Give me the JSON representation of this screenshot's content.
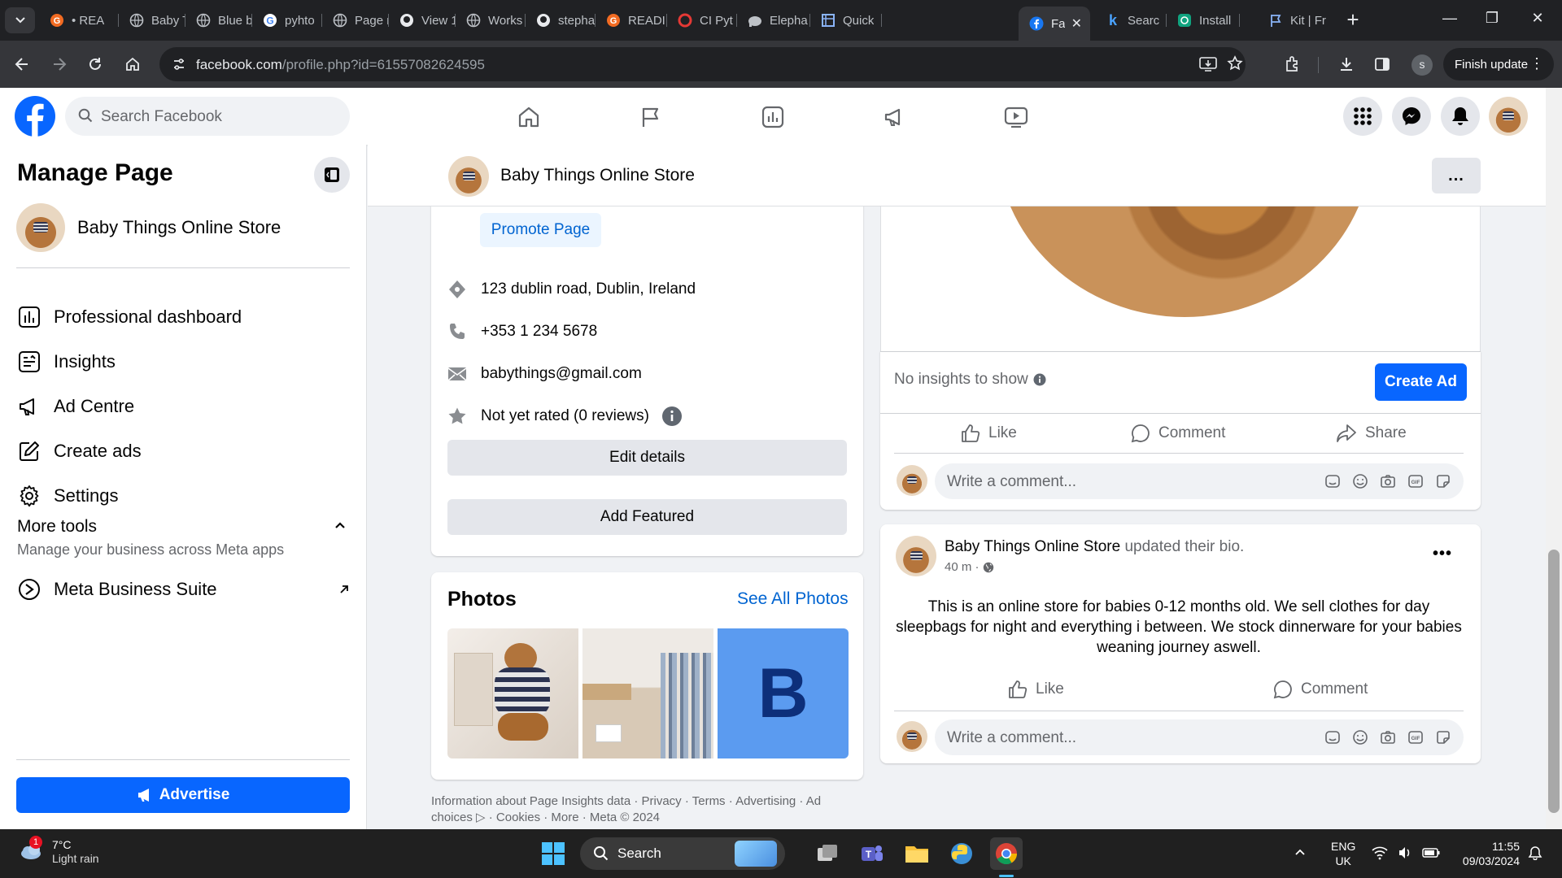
{
  "browser": {
    "tabs": [
      {
        "label": "• REA",
        "icon": "g-icon"
      },
      {
        "label": "Baby T",
        "icon": "globe-icon"
      },
      {
        "label": "Blue b",
        "icon": "globe-icon"
      },
      {
        "label": "pyhto",
        "icon": "google-icon"
      },
      {
        "label": "Page r",
        "icon": "globe-icon"
      },
      {
        "label": "View 1",
        "icon": "github-icon"
      },
      {
        "label": "Works",
        "icon": "globe-icon"
      },
      {
        "label": "stepha",
        "icon": "github-icon"
      },
      {
        "label": "READI",
        "icon": "g-icon"
      },
      {
        "label": "CI Pyt",
        "icon": "ci-icon"
      },
      {
        "label": "Elepha",
        "icon": "elephant-icon"
      },
      {
        "label": "Quick",
        "icon": "quickstart-icon"
      },
      {
        "label": "Fa",
        "icon": "facebook-icon",
        "active": true
      },
      {
        "label": "Searc",
        "icon": "kit-icon"
      },
      {
        "label": "Install",
        "icon": "openai-icon"
      },
      {
        "label": "Kit | Fr",
        "icon": "flag-icon"
      }
    ],
    "url_host": "facebook.com",
    "url_path": "/profile.php?id=61557082624595",
    "profile_initial": "s",
    "finish_update": "Finish update"
  },
  "fb": {
    "search_placeholder": "Search Facebook",
    "nav_icons": [
      "home-icon",
      "flag-icon",
      "insights-icon",
      "megaphone-icon",
      "video-icon"
    ]
  },
  "sidebar": {
    "title": "Manage Page",
    "page_name": "Baby Things Online Store",
    "items": [
      {
        "label": "Professional dashboard",
        "icon": "dashboard-icon"
      },
      {
        "label": "Insights",
        "icon": "insights-icon"
      },
      {
        "label": "Ad Centre",
        "icon": "megaphone-icon"
      },
      {
        "label": "Create ads",
        "icon": "edit-icon"
      },
      {
        "label": "Settings",
        "icon": "gear-icon"
      }
    ],
    "more_tools": "More tools",
    "more_tools_sub": "Manage your business across Meta apps",
    "meta_suite": "Meta Business Suite",
    "advertise": "Advertise"
  },
  "subheader": {
    "page_name": "Baby Things Online Store",
    "more": "..."
  },
  "intro": {
    "promote": "Promote Page",
    "address": "123 dublin road, Dublin, Ireland",
    "phone": "+353 1 234 5678",
    "email": "babythings@gmail.com",
    "rating": "Not yet rated (0 reviews)",
    "edit_details": "Edit details",
    "add_featured": "Add Featured"
  },
  "photos": {
    "title": "Photos",
    "see_all": "See All Photos",
    "letter_tile": "B"
  },
  "footer": "Information about Page Insights data · Privacy · Terms · Advertising · Ad choices ▷ · Cookies · More · Meta © 2024",
  "feed": {
    "no_insights": "No insights to show",
    "create_ad": "Create Ad",
    "like": "Like",
    "comment": "Comment",
    "share": "Share",
    "comment_placeholder": "Write a comment...",
    "post": {
      "author": "Baby Things Online Store",
      "action": "updated their bio.",
      "time": "40 m ·",
      "body": "This is an online store for babies 0-12 months old. We sell clothes for day sleepbags for night and everything i between. We stock dinnerware for your babies weaning journey aswell."
    }
  },
  "taskbar": {
    "weather_temp": "7°C",
    "weather_desc": "Light rain",
    "weather_badge": "1",
    "search": "Search",
    "lang": "ENG",
    "region": "UK",
    "time": "11:55",
    "date": "09/03/2024"
  },
  "colors": {
    "fb_blue": "#0866ff",
    "link_blue": "#0064d1",
    "chrome_dark": "#202124",
    "chrome_toolbar": "#35363a"
  }
}
